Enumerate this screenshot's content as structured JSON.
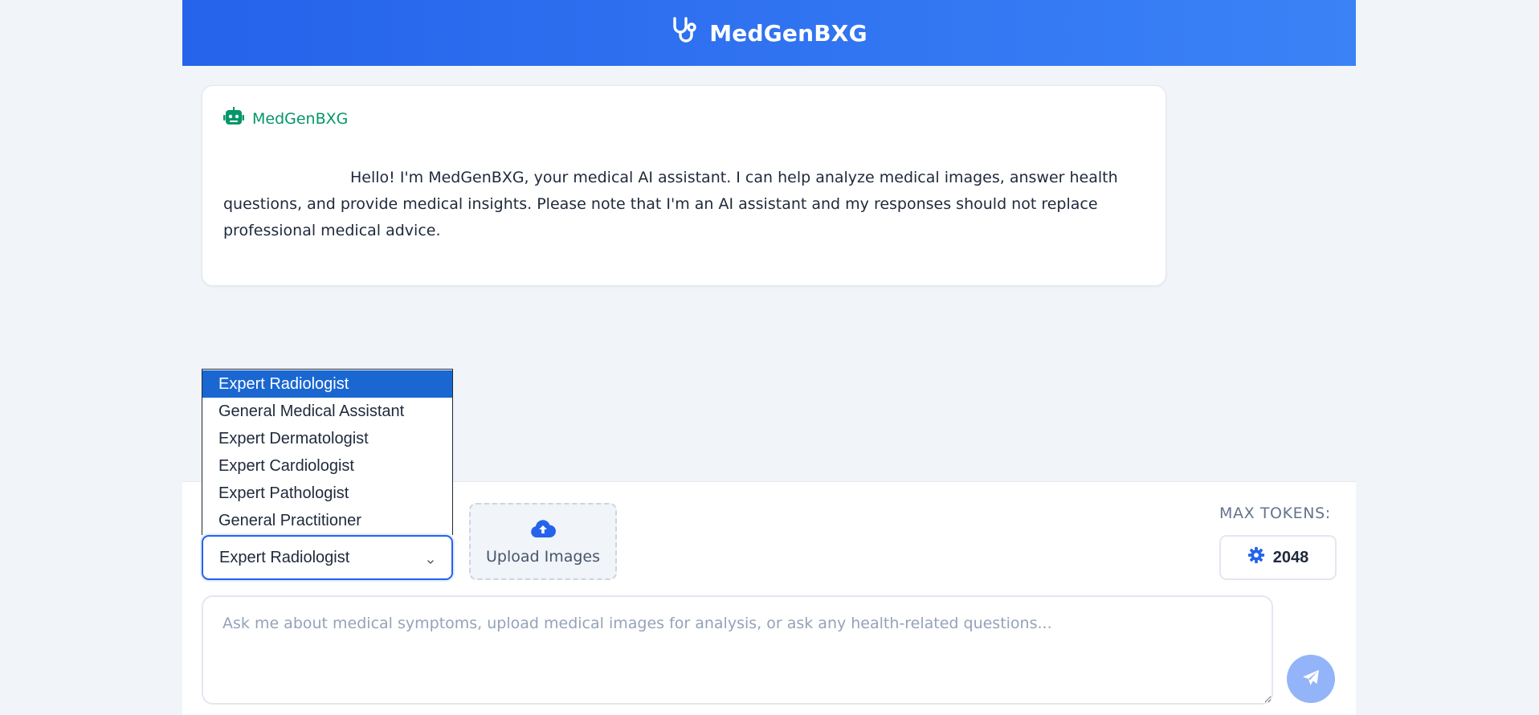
{
  "header": {
    "title": "MedGenBXG",
    "icon": "stethoscope-icon"
  },
  "message": {
    "sender": "MedGenBXG",
    "sender_icon": "robot-icon",
    "text": "Hello! I'm MedGenBXG, your medical AI assistant. I can help analyze medical images, answer health questions, and provide medical insights. Please note that I'm an AI assistant and my responses should not replace professional medical advice."
  },
  "role_select": {
    "selected": "Expert Radiologist",
    "options": [
      "Expert Radiologist",
      "General Medical Assistant",
      "Expert Dermatologist",
      "Expert Cardiologist",
      "Expert Pathologist",
      "General Practitioner"
    ]
  },
  "upload": {
    "label": "Upload Images",
    "icon": "cloud-upload-icon"
  },
  "tokens": {
    "label": "MAX TOKENS:",
    "value": "2048",
    "icon": "gear-icon"
  },
  "chat": {
    "placeholder": "Ask me about medical symptoms, upload medical images for analysis, or ask any health-related questions..."
  },
  "send": {
    "icon": "paper-plane-icon"
  },
  "colors": {
    "primary": "#2563eb",
    "assistant_green": "#059669",
    "selected_option": "#1a67d2",
    "send_button": "#93b4f8"
  }
}
